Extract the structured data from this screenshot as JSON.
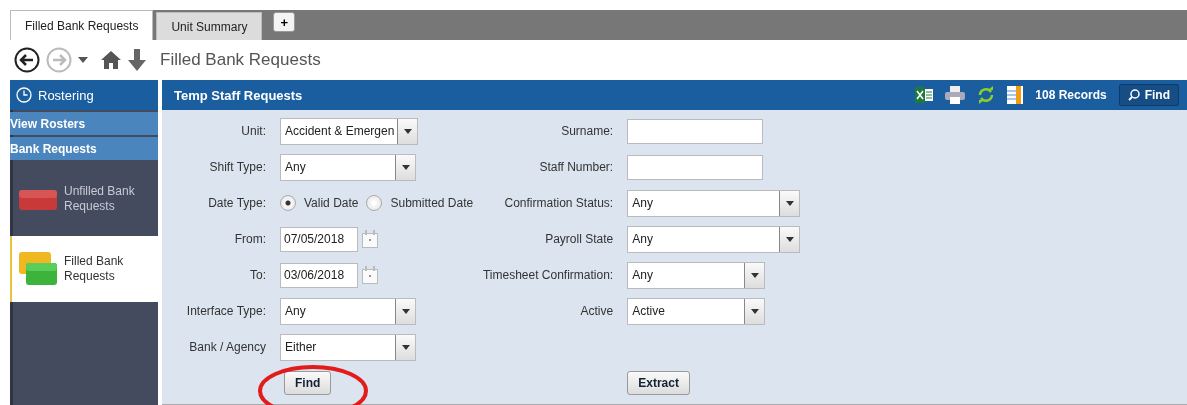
{
  "tabs": [
    {
      "label": "Filled Bank Requests",
      "selected": true
    },
    {
      "label": "Unit Summary",
      "selected": false
    }
  ],
  "add_tab": "+",
  "nav": {
    "title": "Filled Bank Requests"
  },
  "sidebar": {
    "header": "Rostering",
    "sections": [
      "View Rosters",
      "Bank Requests"
    ],
    "items": [
      {
        "label": "Unfilled Bank Requests",
        "kind": "single",
        "selected": false
      },
      {
        "label": "Filled Bank Requests",
        "kind": "stacked",
        "selected": true
      }
    ]
  },
  "panel": {
    "title": "Temp Staff Requests",
    "records": "108 Records",
    "find": "Find"
  },
  "left_fields": [
    {
      "label": "Unit:",
      "kind": "select",
      "value": "Accident & Emergen"
    },
    {
      "label": "Shift Type:",
      "kind": "select",
      "value": "Any"
    },
    {
      "label": "Date Type:",
      "kind": "radio",
      "options": [
        {
          "label": "Valid Date",
          "selected": true
        },
        {
          "label": "Submitted Date",
          "selected": false
        }
      ]
    },
    {
      "label": "From:",
      "kind": "date",
      "value": "07/05/2018"
    },
    {
      "label": "To:",
      "kind": "date",
      "value": "03/06/2018"
    },
    {
      "label": "Interface Type:",
      "kind": "select",
      "value": "Any"
    },
    {
      "label": "Bank / Agency",
      "kind": "select",
      "value": "Either"
    }
  ],
  "right_fields": [
    {
      "label": "Surname:",
      "kind": "text"
    },
    {
      "label": "Staff Number:",
      "kind": "text"
    },
    {
      "label": "Confirmation Status:",
      "kind": "select",
      "value": "Any"
    },
    {
      "label": "Payroll State",
      "kind": "select",
      "value": "Any"
    },
    {
      "label": "Timesheet Confirmation:",
      "kind": "select",
      "value": "Any"
    },
    {
      "label": "Active",
      "kind": "select",
      "value": "Active"
    }
  ],
  "buttons": {
    "left": "Find",
    "right": "Extract"
  }
}
